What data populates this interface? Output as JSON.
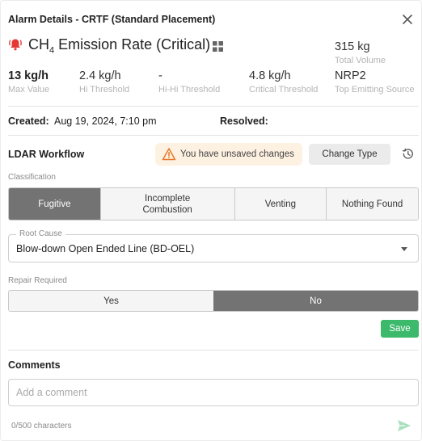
{
  "header": {
    "title": "Alarm Details - CRTF (Standard Placement)",
    "close_icon": "close-icon"
  },
  "alarm": {
    "name_prefix": "CH",
    "name_subscript": "4",
    "name_suffix": " Emission Rate (Critical)",
    "bell_icon": "bell-icon",
    "grid_icon": "grid-icon",
    "status_color": "#e53935"
  },
  "metrics": {
    "max_value": {
      "value": "13 kg/h",
      "label": "Max Value"
    },
    "hi_threshold": {
      "value": "2.4 kg/h",
      "label": "Hi Threshold"
    },
    "hi_hi_threshold": {
      "value": "-",
      "label": "Hi-Hi Threshold"
    },
    "critical_threshold": {
      "value": "4.8 kg/h",
      "label": "Critical Threshold"
    },
    "total_volume": {
      "value": "315 kg",
      "label": "Total Volume"
    },
    "top_emitting_source": {
      "value": "NRP2",
      "label": "Top Emitting Source"
    }
  },
  "created": {
    "label": "Created:",
    "value": "Aug 19, 2024, 7:10 pm"
  },
  "resolved": {
    "label": "Resolved:",
    "value": ""
  },
  "ldar": {
    "title": "LDAR Workflow",
    "unsaved_text": "You have unsaved changes",
    "warning_color": "#e8782a",
    "change_type_label": "Change Type",
    "history_icon": "history-icon"
  },
  "classification": {
    "label": "Classification",
    "options": [
      "Fugitive",
      "Incomplete Combustion",
      "Venting",
      "Nothing Found"
    ],
    "selected": "Fugitive"
  },
  "root_cause": {
    "label": "Root Cause",
    "value": "Blow-down Open Ended Line (BD-OEL)"
  },
  "repair": {
    "label": "Repair Required",
    "options": [
      "Yes",
      "No"
    ],
    "selected": "No"
  },
  "save_label": "Save",
  "save_color": "#3cb96b",
  "comments": {
    "title": "Comments",
    "placeholder": "Add a comment",
    "value": "",
    "char_count": "0/500 characters",
    "send_icon": "send-icon"
  }
}
